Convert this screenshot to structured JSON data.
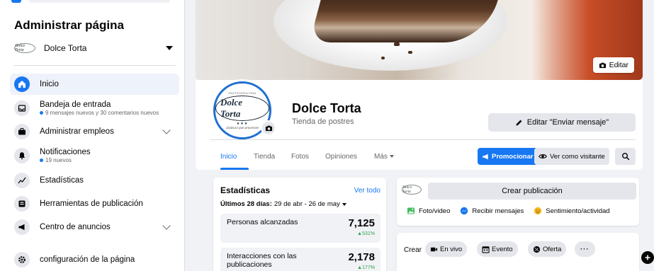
{
  "sidebar": {
    "title": "Administrar página",
    "page_name": "Dolce Torta",
    "logo_text": "Dolce Torta",
    "items": [
      {
        "label": "Inicio",
        "sub": ""
      },
      {
        "label": "Bandeja de entrada",
        "sub": "9 mensajes nuevos y 30 comentarios nuevos"
      },
      {
        "label": "Administrar empleos",
        "sub": ""
      },
      {
        "label": "Notificaciones",
        "sub": "19 nuevos"
      },
      {
        "label": "Estadísticas",
        "sub": ""
      },
      {
        "label": "Herramientas de publicación",
        "sub": ""
      },
      {
        "label": "Centro de anuncios",
        "sub": ""
      },
      {
        "label": "configuración de la página",
        "sub": ""
      }
    ]
  },
  "cover": {
    "edit_label": "Editar"
  },
  "profile": {
    "logo_top": "PASTELERIA FINA",
    "logo_main": "Dolce Torta",
    "logo_stars": "★★★",
    "logo_tag": "¡Dulzura que procesas!",
    "name": "Dolce Torta",
    "category": "Tienda de postres",
    "edit_message_label": "Editar \"Enviar mensaje\""
  },
  "tabs": [
    {
      "label": "Inicio"
    },
    {
      "label": "Tienda"
    },
    {
      "label": "Fotos"
    },
    {
      "label": "Opiniones"
    },
    {
      "label": "Más"
    }
  ],
  "actions": {
    "promote": "Promocionar",
    "view_as_visitor": "Ver como visitante"
  },
  "stats": {
    "title": "Estadísticas",
    "link": "Ver todo",
    "range_label": "Últimos 28 días:",
    "range_value": "29 de abr - 26 de may",
    "metrics": [
      {
        "label": "Personas alcanzadas",
        "value": "7,125",
        "delta": "▲531%"
      },
      {
        "label": "Interacciones con las publicaciones",
        "value": "2,178",
        "delta": "▲177%"
      }
    ]
  },
  "post": {
    "logo_text": "Dolce Torta",
    "create_label": "Crear publicación",
    "actions": [
      "Foto/video",
      "Recibir mensajes",
      "Sentimiento/actividad"
    ]
  },
  "create": {
    "label": "Crear",
    "chips": [
      "En vivo",
      "Evento",
      "Oferta",
      "···"
    ]
  },
  "colors": {
    "accent": "#1877f2",
    "positive": "#31a24c",
    "background": "#f0f2f5"
  }
}
